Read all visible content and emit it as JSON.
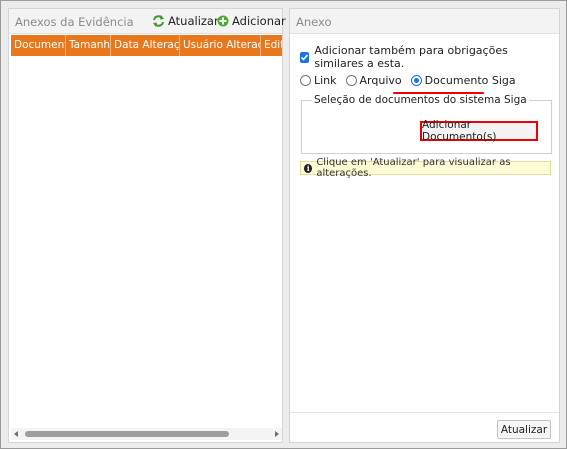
{
  "left_panel": {
    "title": "Anexos da Evidência",
    "refresh_label": "Atualizar",
    "add_label": "Adicionar",
    "columns": [
      "Documento",
      "Tamanho",
      "Data Alteração",
      "Usuário Alteração",
      "Editar"
    ]
  },
  "right_panel": {
    "title": "Anexo",
    "checkbox_label": "Adicionar também para obrigações similares a esta.",
    "radio_options": [
      "Link",
      "Arquivo",
      "Documento Siga"
    ],
    "selected_option": "Documento Siga",
    "fieldset_legend": "Seleção de documentos do sistema Siga",
    "add_document_label": "Adicionar Documento(s)",
    "info_text": "Clique em 'Atualizar' para visualizar as alterações.",
    "update_button": "Atualizar"
  },
  "colors": {
    "grid_header": "#e8781e",
    "highlight": "#ee0000",
    "accent": "#1a73e8"
  },
  "icons": [
    "refresh-icon",
    "add-icon",
    "check-icon",
    "info-icon"
  ]
}
